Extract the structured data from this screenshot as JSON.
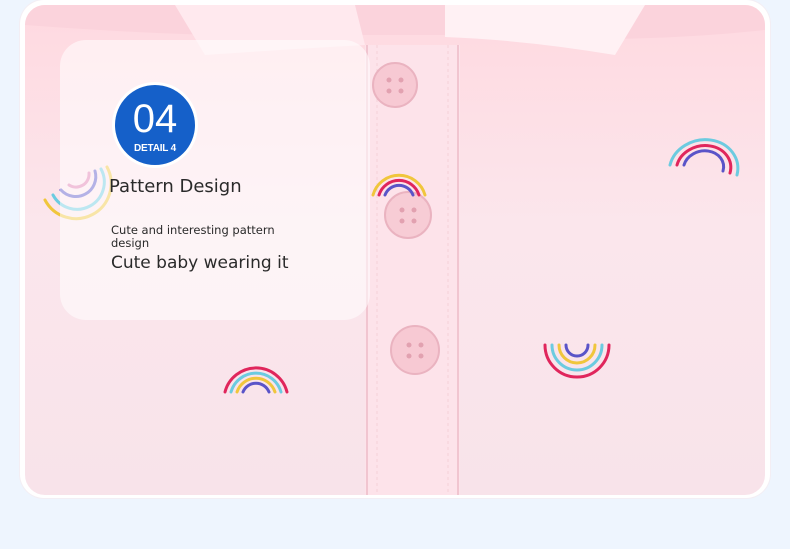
{
  "detail_badge": {
    "number": "04",
    "label": "DETAIL 4"
  },
  "feature": {
    "title": "Pattern Design",
    "subtitle": "Cute and interesting pattern design",
    "caption": "Cute baby wearing it"
  },
  "colors": {
    "background": "#eef5fe",
    "badge_blue": "#1560c9",
    "fabric_pink": "#fbe6ec",
    "text": "#2a2a2a"
  },
  "product_image": {
    "subject": "pink polo shirt with embroidered rainbows"
  }
}
